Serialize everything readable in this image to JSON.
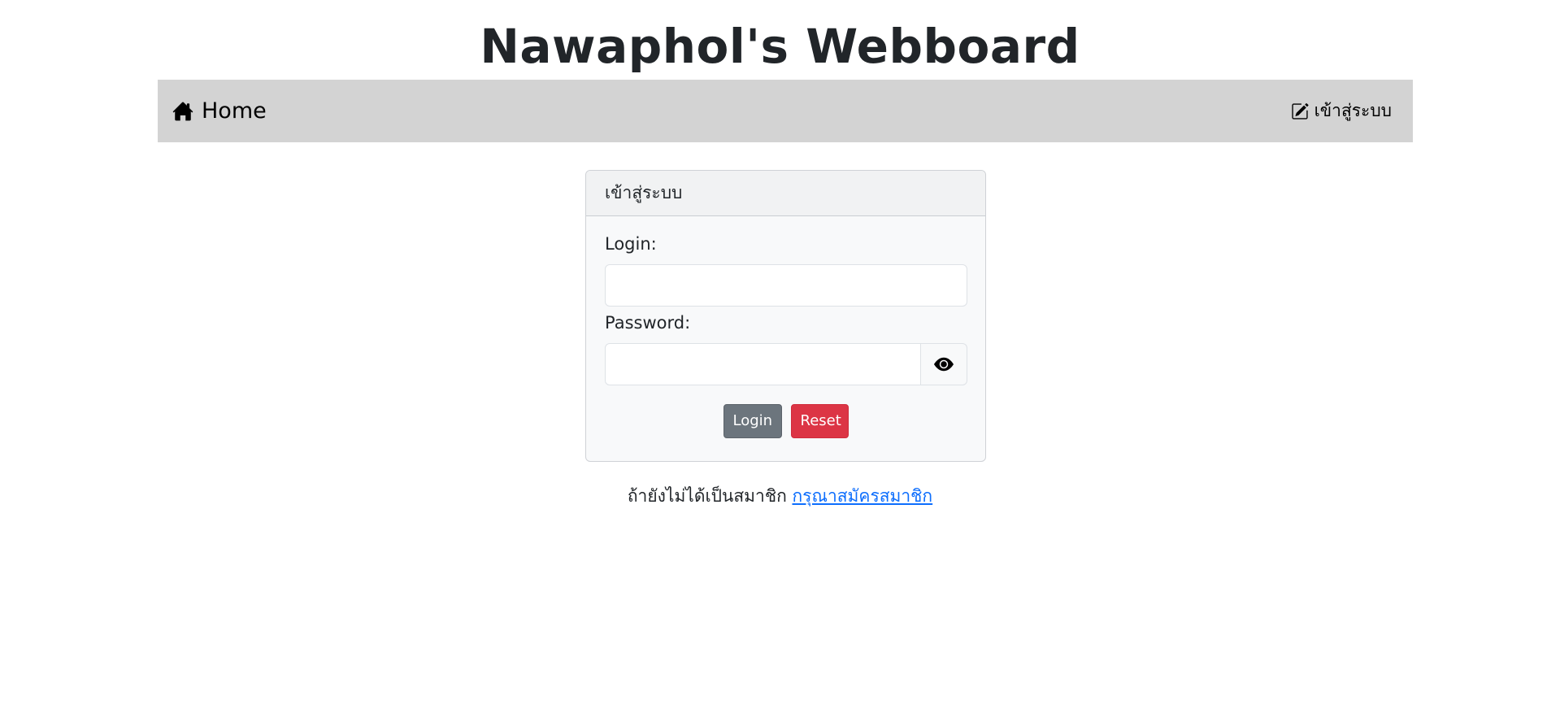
{
  "header": {
    "title": "Nawaphol's Webboard"
  },
  "navbar": {
    "home_label": "Home",
    "home_icon": "house-icon",
    "login_label": "เข้าสู่ระบบ",
    "login_icon": "pencil-square-icon",
    "background": "#d3d3d3"
  },
  "login_card": {
    "header": "เข้าสู่ระบบ",
    "login_label": "Login:",
    "login_value": "",
    "password_label": "Password:",
    "password_value": "",
    "toggle_icon": "eye-icon",
    "login_button": "Login",
    "reset_button": "Reset",
    "login_button_color": "#6c757d",
    "reset_button_color": "#dc3545"
  },
  "footer": {
    "prompt": "ถ้ายังไม่ได้เป็นสมาชิก",
    "register_link": "กรุณาสมัครสมาชิก",
    "link_color": "#0d6efd"
  }
}
